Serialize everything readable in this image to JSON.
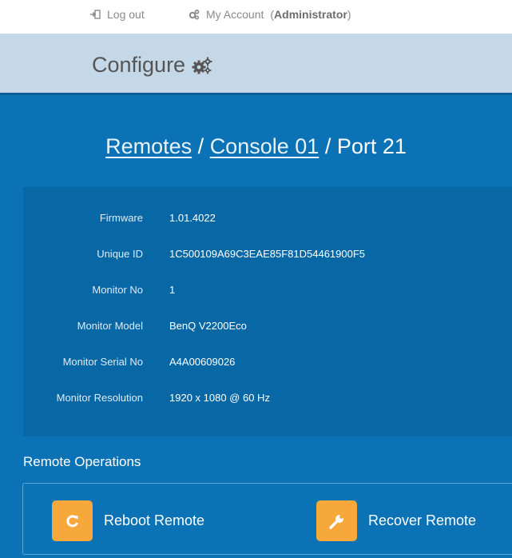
{
  "topbar": {
    "logout_label": "Log out",
    "account_label": "My Account",
    "account_role": "Administrator"
  },
  "header": {
    "title": "Configure",
    "icon": "gears-icon"
  },
  "breadcrumb": {
    "items": [
      "Remotes",
      "Console 01"
    ],
    "current": "Port 21",
    "separator": "/"
  },
  "details": [
    {
      "label": "Firmware",
      "value": "1.01.4022"
    },
    {
      "label": "Unique ID",
      "value": "1C500109A69C3EAE85F81D54461900F5"
    },
    {
      "label": "Monitor No",
      "value": "1"
    },
    {
      "label": "Monitor Model",
      "value": "BenQ V2200Eco"
    },
    {
      "label": "Monitor Serial No",
      "value": "A4A00609026"
    },
    {
      "label": "Monitor Resolution",
      "value": "1920 x 1080 @ 60 Hz"
    }
  ],
  "operations": {
    "title": "Remote Operations",
    "reboot_label": "Reboot Remote",
    "recover_label": "Recover Remote"
  },
  "colors": {
    "content_blue": "#0b72b5",
    "details_blue": "#0868a6",
    "header_bg": "#c5d8e8",
    "accent_orange": "#f7a83b"
  }
}
